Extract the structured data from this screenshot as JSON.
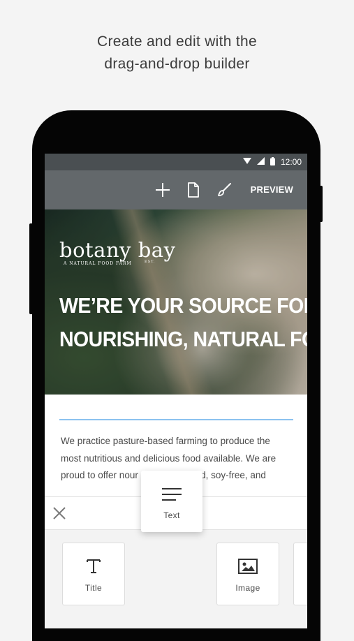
{
  "headline": {
    "line1": "Create and edit with the",
    "line2": "drag-and-drop builder"
  },
  "status_bar": {
    "time": "12:00",
    "icons": [
      "wifi-icon",
      "signal-icon",
      "battery-icon"
    ]
  },
  "toolbar": {
    "icons": [
      "plus-icon",
      "page-icon",
      "brush-icon"
    ],
    "preview_label": "PREVIEW"
  },
  "hero": {
    "logo_text": "botany bay",
    "logo_tagline": "A NATURAL FOOD FARM",
    "logo_est": "EST.",
    "title_line1": "WE’RE YOUR SOURCE FOR",
    "title_line2": "NOURISHING, NATURAL FOOD"
  },
  "body": {
    "line1": "We practice pasture-based farming to produce the",
    "line2": "most nutritious and delicious food available.  We are",
    "line3": "proud to offer nour",
    "line3_tail": "fed, soy-free, and"
  },
  "tray": {
    "close_icon": "close-icon",
    "tiles": [
      {
        "label": "Title",
        "icon": "text-t-icon"
      },
      {
        "label": "Image",
        "icon": "image-icon"
      }
    ],
    "dragging": {
      "label": "Text",
      "icon": "text-lines-icon"
    }
  },
  "colors": {
    "toolbar": "#63686b",
    "status_bar": "#4a4f52",
    "accent_line": "#8cc2f0"
  }
}
